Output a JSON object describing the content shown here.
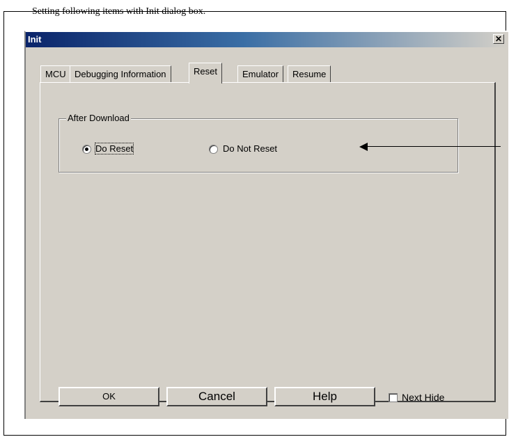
{
  "page": {
    "top_text": "Setting following items with Init dialog box."
  },
  "dialog": {
    "title": "Init",
    "close_symbol": "✕"
  },
  "tabs": [
    {
      "label": "MCU"
    },
    {
      "label": "Debugging Information"
    },
    {
      "label": "Reset"
    },
    {
      "label": "Emulator"
    },
    {
      "label": "Resume"
    }
  ],
  "active_tab": "Reset",
  "group": {
    "label": "After Download",
    "options": [
      {
        "label": "Do Reset",
        "selected": true
      },
      {
        "label": "Do Not Reset",
        "selected": false
      }
    ]
  },
  "buttons": {
    "ok": "OK",
    "cancel": "Cancel",
    "help": "Help"
  },
  "checkbox": {
    "label": "Next Hide",
    "checked": false
  },
  "colors": {
    "titlebar_start": "#0a246a",
    "titlebar_end": "#d4d0c8",
    "face": "#d4d0c8"
  }
}
